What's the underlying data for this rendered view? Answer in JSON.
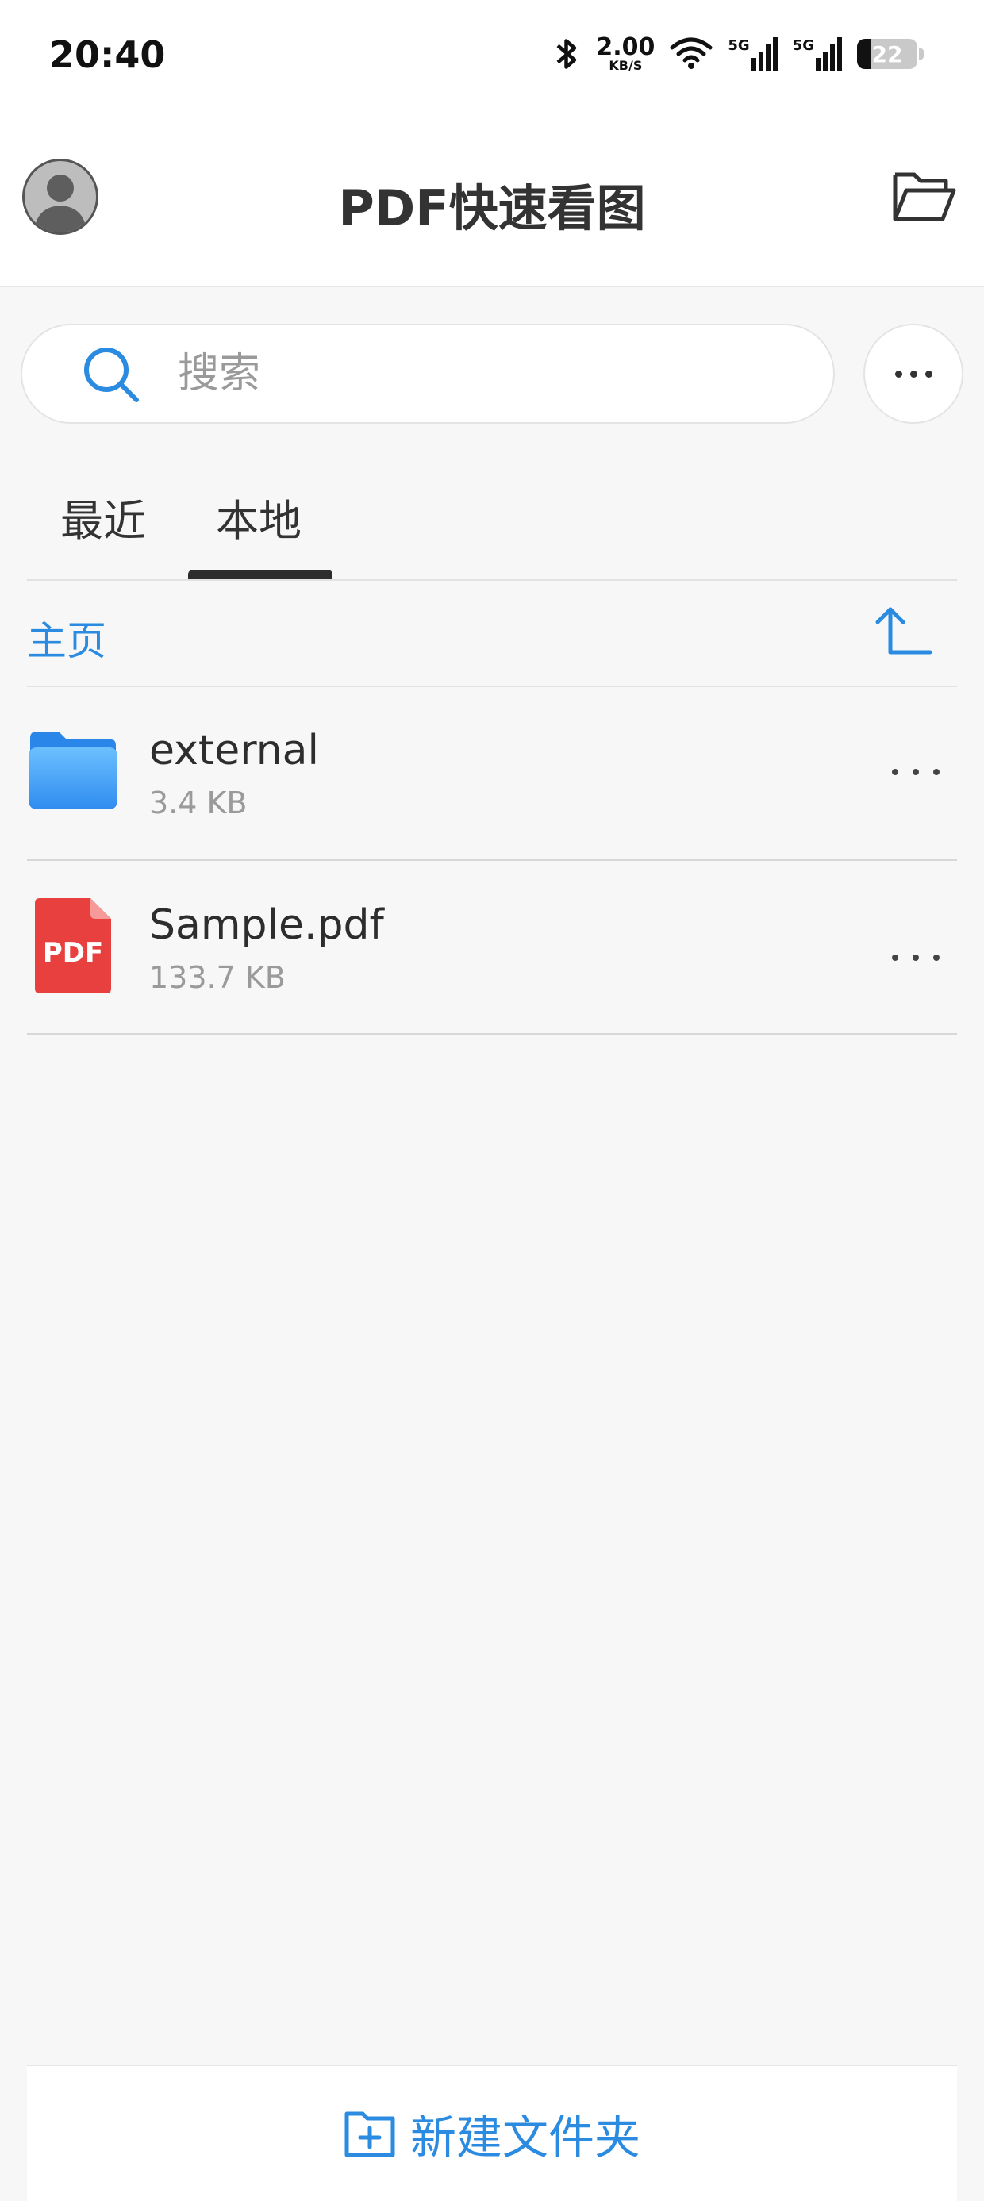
{
  "status_bar": {
    "time": "20:40",
    "net_speed_value": "2.00",
    "net_speed_unit": "KB/S",
    "signal_1_label": "5G",
    "signal_2_label": "5G",
    "battery_level": "22",
    "icons": [
      "bluetooth-icon",
      "wifi-icon",
      "signal-5g-icon",
      "signal-5g-icon",
      "battery-icon"
    ]
  },
  "header": {
    "title": "PDF快速看图",
    "left_icon": "avatar-icon",
    "right_icon": "folder-open-icon"
  },
  "search": {
    "placeholder": "搜索",
    "value": "",
    "icon": "search-icon"
  },
  "tabs": [
    {
      "label": "最近",
      "active": false
    },
    {
      "label": "本地",
      "active": true
    }
  ],
  "breadcrumb": {
    "label": "主页",
    "up_icon": "up-arrow-icon"
  },
  "files": [
    {
      "name": "external",
      "size": "3.4 KB",
      "type": "folder",
      "icon": "folder-icon"
    },
    {
      "name": "Sample.pdf",
      "size": "133.7 KB",
      "type": "pdf",
      "icon": "pdf-file-icon",
      "icon_text": "PDF"
    }
  ],
  "bottom_bar": {
    "new_folder_label": "新建文件夹",
    "icon": "new-folder-icon"
  },
  "colors": {
    "accent": "#2a8be0",
    "pdf_red": "#e8403f",
    "folder_blue": "#3a9cf5",
    "background": "#f7f7f7"
  }
}
